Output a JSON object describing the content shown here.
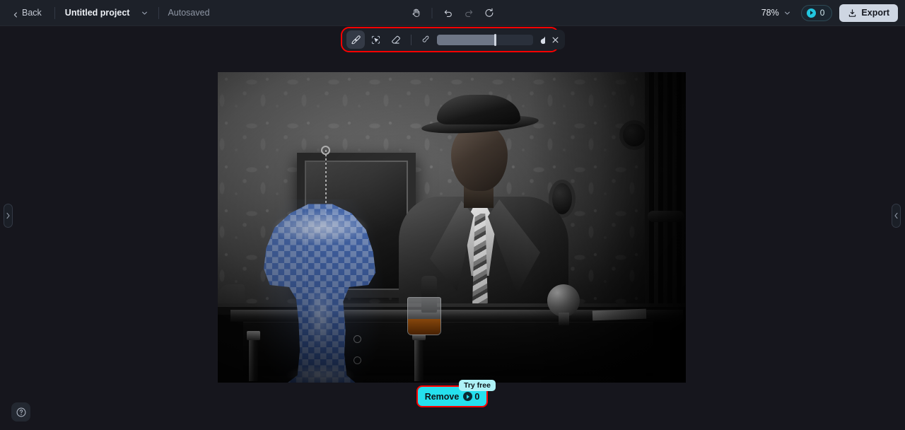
{
  "header": {
    "back_label": "Back",
    "project_name": "Untitled project",
    "autosaved_label": "Autosaved",
    "zoom_level": "78%",
    "credits_count": "0",
    "export_label": "Export",
    "icons": {
      "back_chevron": "chevron-left-icon",
      "project_caret": "chevron-down-icon",
      "pan": "hand-pan-icon",
      "undo": "undo-icon",
      "redo": "redo-icon",
      "reset": "reset-icon",
      "zoom_caret": "chevron-down-icon",
      "credit": "credit-token-icon",
      "export": "download-icon"
    }
  },
  "edit_toolbar": {
    "tools": [
      {
        "name": "brush-tool",
        "icon": "paintbrush-icon",
        "active": true
      },
      {
        "name": "smart-select-tool",
        "icon": "magic-select-cursor-icon",
        "active": false
      },
      {
        "name": "eraser-tool",
        "icon": "eraser-icon",
        "active": false
      }
    ],
    "brush_size_min_icon": "small-brush-icon",
    "brush_size_max_icon": "large-brush-icon",
    "brush_size_percent": 60,
    "close_label": "close-icon",
    "highlight_color": "#ff0000"
  },
  "canvas": {
    "image_alt": "Black and white photo of a man in suit and fedora seated at a dark desk with a table lamp, whisky glass and framed picture on patterned wallpaper",
    "selection_mask_label": "table-lamp-selection-mask",
    "mask_color": "#6a8fdd"
  },
  "side_panels": {
    "left_toggle_icon": "chevron-right-icon",
    "right_toggle_icon": "chevron-left-icon"
  },
  "help": {
    "icon": "question-mark-icon"
  },
  "action_bar": {
    "remove_label": "Remove",
    "remove_cost": "0",
    "try_free_label": "Try free",
    "accent_color": "#25e0ee",
    "highlight_color": "#ff0000"
  }
}
